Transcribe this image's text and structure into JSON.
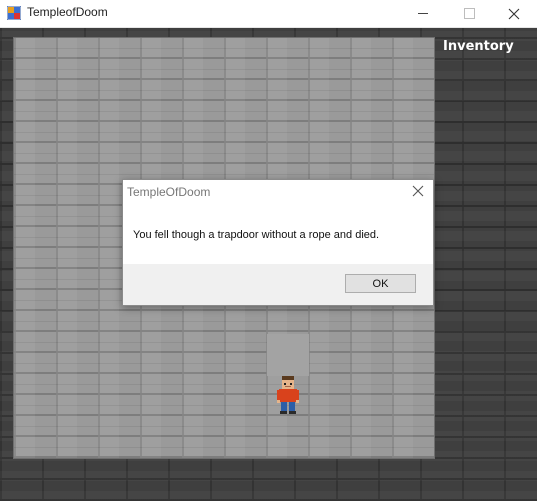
{
  "window": {
    "title": "TempleofDoom",
    "icon": "app-icon",
    "controls": [
      "minimize-icon",
      "maximize-icon",
      "close-icon"
    ]
  },
  "game": {
    "inventory_label": "Inventory",
    "player_icon": "player-sprite"
  },
  "dialog": {
    "title": "TempleOfDoom",
    "message": "You fell though a trapdoor without a rope and died.",
    "ok_label": "OK",
    "close_icon": "close-icon"
  },
  "colors": {
    "board_brick": "#9a9a9a",
    "outer_brick": "#3f3f3f",
    "dialog_bg": "#ffffff",
    "dialog_footer": "#f0f0f0"
  }
}
